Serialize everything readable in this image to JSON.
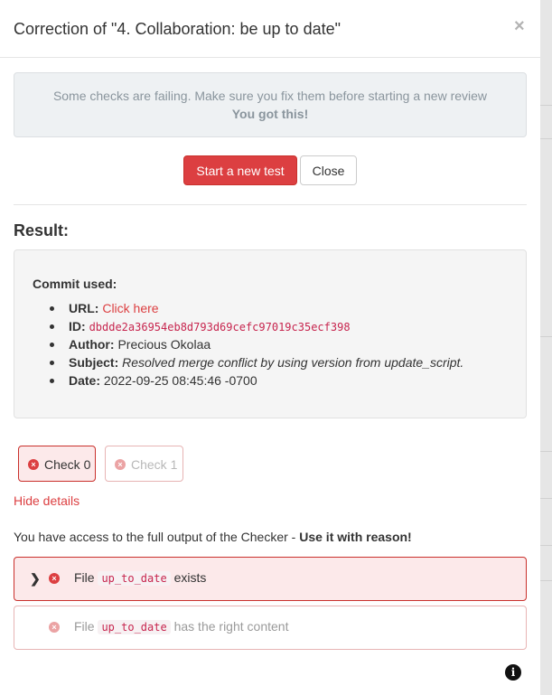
{
  "modal": {
    "title": "Correction of \"4. Collaboration: be up to date\"",
    "close_glyph": "×"
  },
  "alert": {
    "message": "Some checks are failing. Make sure you fix them before starting a new review",
    "encouragement": "You got this!"
  },
  "buttons": {
    "start_new_test": "Start a new test",
    "close": "Close"
  },
  "result": {
    "heading": "Result:",
    "commit_label": "Commit used:",
    "fields": {
      "url_label": "URL:",
      "url_link": "Click here",
      "id_label": "ID:",
      "id_value": "dbdde2a36954eb8d793d69cefc97019c35ecf398",
      "author_label": "Author:",
      "author_value": "Precious Okolaa",
      "subject_label": "Subject:",
      "subject_value": "Resolved merge conflict by using version from update_script.",
      "date_label": "Date:",
      "date_value": "2022-09-25 08:45:46 -0700"
    }
  },
  "checks": [
    {
      "label": "Check 0",
      "status": "failed",
      "active": true,
      "icon": "x-circle-icon"
    },
    {
      "label": "Check 1",
      "status": "failed",
      "active": false,
      "icon": "x-circle-icon"
    }
  ],
  "hide_details": "Hide details",
  "access_notice": {
    "text": "You have access to the full output of the Checker - ",
    "emphasis": "Use it with reason!"
  },
  "check_results": [
    {
      "prefix": "File",
      "filename": "up_to_date",
      "suffix": "exists",
      "status": "failed",
      "expandable": true
    },
    {
      "prefix": "File",
      "filename": "up_to_date",
      "suffix": "has the right content",
      "status": "failed",
      "expandable": false
    }
  ],
  "glyphs": {
    "x": "×",
    "chevron": "❯",
    "info": "i"
  },
  "colors": {
    "danger": "#dc3f41",
    "danger_light": "#fce9ea",
    "muted_text": "#8a959d",
    "alert_bg": "#eef1f3",
    "well_bg": "#f5f5f5",
    "code": "#c7254e"
  }
}
